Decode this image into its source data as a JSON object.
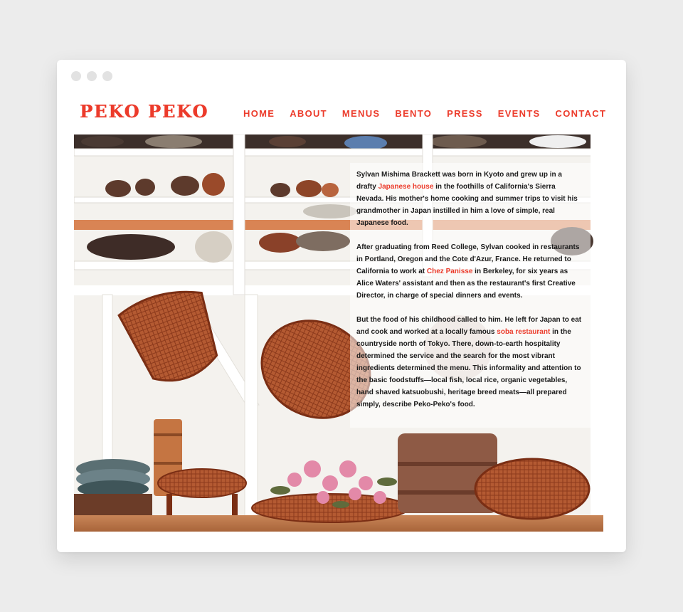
{
  "site": {
    "logo": "PEKO PEKO",
    "nav": [
      "HOME",
      "ABOUT",
      "MENUS",
      "BENTO",
      "PRESS",
      "EVENTS",
      "CONTACT"
    ]
  },
  "colors": {
    "accent": "#ec3b2b",
    "background": "#ececec",
    "window": "#ffffff"
  },
  "story": {
    "p1": {
      "a": "Sylvan Mishima Brackett was born in Kyoto and grew up in a drafty ",
      "link": "Japanese house",
      "b": " in the foothills of California's Sierra Nevada. His mother's home cooking and summer trips to visit his grandmother in Japan instilled in him a love of simple, real Japanese food."
    },
    "p2": {
      "a": "After graduating from Reed College, Sylvan cooked in restaurants in Portland, Oregon and the Cote d'Azur, France. He returned to California to work at ",
      "link": "Chez Panisse",
      "b": " in Berkeley, for six years as Alice Waters' assistant and then as the restaurant's first Creative Director, in charge of special dinners and events."
    },
    "p3": {
      "a": "But the food of his childhood called to him. He left for Japan to eat and cook and worked at a locally famous ",
      "link": "soba restaurant",
      "b": " in the countryside north of Tokyo. There, down-to-earth hospitality determined the service and the search for the most vibrant ingredients determined the menu. This informality and attention to the basic foodstuffs—local fish, local rice, organic vegetables, hand shaved katsuobushi, heritage breed meats—all prepared simply, describe Peko-Peko's food."
    }
  }
}
